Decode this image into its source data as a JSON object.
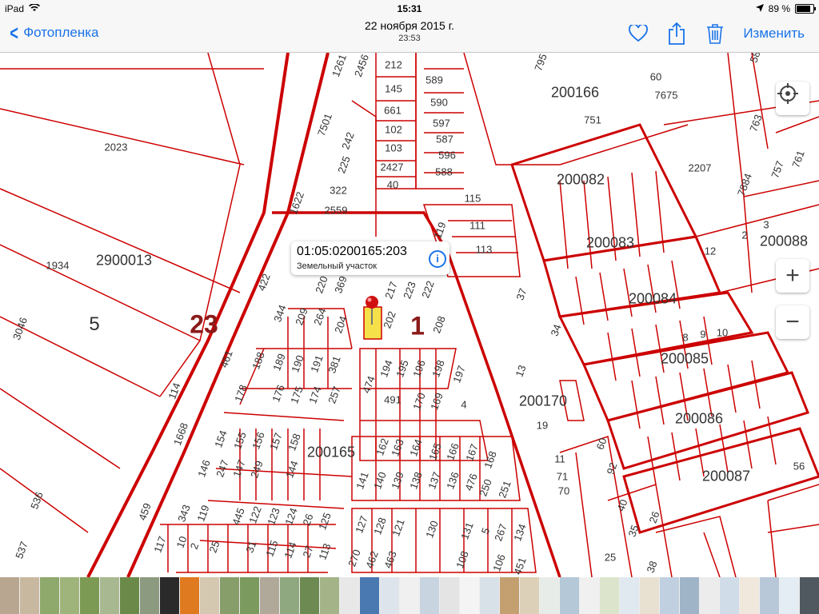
{
  "status_bar": {
    "device": "iPad",
    "time": "15:31",
    "battery": "89 %",
    "battery_level": 0.89
  },
  "nav": {
    "back_label": "Фотопленка",
    "title_date": "22 ноября 2015 г.",
    "title_time": "23:53",
    "edit_label": "Изменить",
    "icons": [
      "heart-icon",
      "share-icon",
      "trash-icon"
    ]
  },
  "map": {
    "callout": {
      "cadastral_number": "01:05:0200165:203",
      "subtitle": "Земельный участок",
      "info": "i"
    },
    "zoom_in": "+",
    "zoom_out": "−",
    "line_color": "#cc0000",
    "highlight_color": "#f5e04a",
    "labels": {
      "q2900013": "2900013",
      "l2023": "2023",
      "l1934": "1934",
      "l5": "5",
      "l3046": "3046",
      "l23": "23",
      "l1": "1",
      "l200165": "200165",
      "l200166": "200166",
      "l200082": "200082",
      "l200083": "200083",
      "l200084": "200084",
      "l200085": "200085",
      "l200086": "200086",
      "l200087": "200087",
      "l200088": "200088",
      "l200170": "200170",
      "l2207": "2207",
      "l751": "751",
      "l7675": "7675",
      "l60": "60",
      "l763": "763",
      "l761": "761",
      "l757": "757",
      "l7884": "7884",
      "l589": "589",
      "l590": "590",
      "l597": "597",
      "l587": "587",
      "l596": "596",
      "l588": "588",
      "l212": "212",
      "l145": "145",
      "l661": "661",
      "l102": "102",
      "l103": "103",
      "l2427": "2427",
      "l40": "40",
      "l1261": "1261",
      "l2456": "2456",
      "l7501": "7501",
      "l242": "242",
      "l225": "225",
      "l322": "322",
      "l2559": "2559",
      "l1622": "1622",
      "l115": "115",
      "l111": "111",
      "l113": "113",
      "l119": "119",
      "l422": "422",
      "l344": "344",
      "l209": "209",
      "l264": "264",
      "l204": "204",
      "l220": "220",
      "l369": "369",
      "l217": "217",
      "l223": "223",
      "l222": "222",
      "l202": "202",
      "l208": "208",
      "l461": "461",
      "l188": "188",
      "l189": "189",
      "l190": "190",
      "l191": "191",
      "l381": "381",
      "l178": "178",
      "l176": "176",
      "l175": "175",
      "l174": "174",
      "l257": "257",
      "l474": "474",
      "l194": "194",
      "l195": "195",
      "l196": "196",
      "l198": "198",
      "l197": "197",
      "l491": "491",
      "l170": "170",
      "l169": "169",
      "l4": "4",
      "l114": "114",
      "l1668": "1668",
      "l154": "154",
      "l155": "155",
      "l156": "156",
      "l157": "157",
      "l158": "158",
      "l162": "162",
      "l163": "163",
      "l164": "164",
      "l165": "165",
      "l166": "166",
      "l167": "167",
      "l146": "146",
      "l247": "247",
      "l147": "147",
      "l249": "249",
      "l144": "144",
      "l141": "141",
      "l140": "140",
      "l139": "139",
      "l138": "138",
      "l137": "137",
      "l136": "136",
      "l476": "476",
      "l250": "250",
      "l251": "251",
      "l168": "168",
      "l536": "536",
      "l537": "537",
      "l459": "459",
      "l343": "343",
      "l119b": "119",
      "l445": "445",
      "l122": "122",
      "l123": "123",
      "l124": "124",
      "l26": "26",
      "l125": "125",
      "l117": "117",
      "l10": "10",
      "l2": "2",
      "l25": "25",
      "l31": "31",
      "l115b": "115",
      "l114b": "114",
      "l27": "27",
      "l113b": "113",
      "l127": "127",
      "l128": "128",
      "l121": "121",
      "l130": "130",
      "l131": "131",
      "l5b": "5",
      "l267": "267",
      "l134": "134",
      "l270": "270",
      "l462": "462",
      "l463": "463",
      "l108": "108",
      "l106": "106",
      "l451": "451",
      "l11": "11",
      "l71": "71",
      "l70": "70",
      "l19": "19",
      "l13": "13",
      "l34": "34",
      "l37": "37",
      "l60b": "60",
      "l92": "92",
      "l40b": "40",
      "l35": "35",
      "l25b": "25",
      "l38": "38",
      "l12": "12",
      "l8": "8",
      "l9": "9",
      "l10b": "10",
      "l56": "56",
      "l3": "3",
      "l2b": "2",
      "l26b": "26",
      "l795": "795",
      "l58": "58"
    }
  },
  "filmstrip": {
    "thumb_colors": [
      "#b8a690",
      "#c9b8a0",
      "#8fa86b",
      "#9fb47a",
      "#7d9a55",
      "#a8b890",
      "#6b8a4a",
      "#8c9a80",
      "#2a2a2a",
      "#e07a20",
      "#d4c8b0",
      "#889e6a",
      "#7a9a5e",
      "#b0a898",
      "#90a880",
      "#6d8a52",
      "#a4b488",
      "#e8e8e8",
      "#4a78b0",
      "#dde4ec",
      "#f0f0f0",
      "#c8d4e0",
      "#e4e4e4",
      "#f4f4f4",
      "#d8e0e8",
      "#c4a070",
      "#dcd0b8",
      "#e8ece8",
      "#b4c8d8",
      "#f0f0f0",
      "#dce4cc",
      "#e0e8f0",
      "#e8e0d0",
      "#c0d0e0",
      "#a0b4c8",
      "#ececec",
      "#d0dce8",
      "#f0e8dc",
      "#b8c8d8",
      "#e4ecf4",
      "#505860",
      "#d0c0b0",
      "#9ab0c4",
      "#e8dcd0"
    ]
  }
}
